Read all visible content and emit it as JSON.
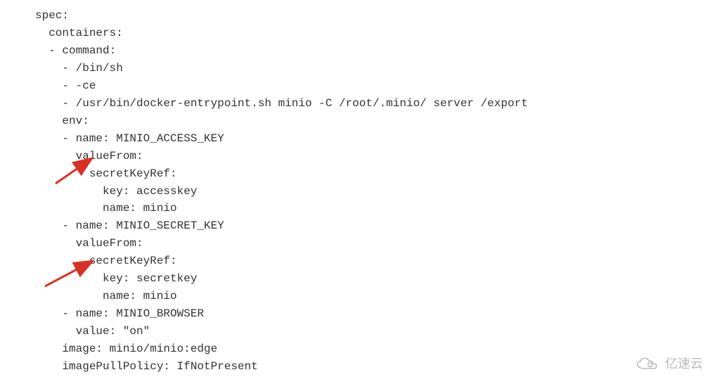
{
  "lines": [
    "spec:",
    "  containers:",
    "  - command:",
    "    - /bin/sh",
    "    - -ce",
    "    - /usr/bin/docker-entrypoint.sh minio -C /root/.minio/ server /export",
    "    env:",
    "    - name: MINIO_ACCESS_KEY",
    "      valueFrom:",
    "        secretKeyRef:",
    "          key: accesskey",
    "          name: minio",
    "    - name: MINIO_SECRET_KEY",
    "      valueFrom:",
    "        secretKeyRef:",
    "          key: secretkey",
    "          name: minio",
    "    - name: MINIO_BROWSER",
    "      value: \"on\"",
    "    image: minio/minio:edge",
    "    imagePullPolicy: IfNotPresent"
  ],
  "watermark": {
    "text": "亿速云"
  }
}
